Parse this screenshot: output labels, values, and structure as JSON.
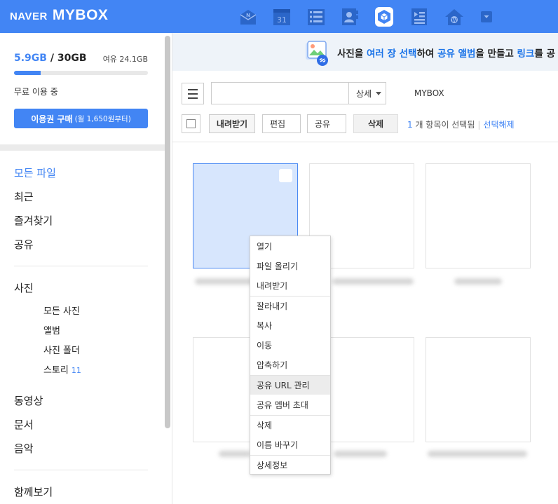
{
  "header": {
    "logo_naver": "NAVER",
    "logo_mybox": "MYBOX",
    "accent_color": "#4285f4",
    "apps": [
      "mail-icon",
      "calendar-icon",
      "list-icon",
      "contacts-icon",
      "mybox-icon",
      "memo-icon",
      "house-icon",
      "more-icon"
    ],
    "calendar_day": "31",
    "mail_letter": "N",
    "house_letter": "W"
  },
  "sidebar": {
    "storage_used": "5.9GB",
    "storage_sep": "/",
    "storage_total": "30GB",
    "storage_free": "여유 24.1GB",
    "storage_used_fraction": 0.197,
    "plan_text": "무료 이용 중",
    "buy_label": "이용권 구매",
    "buy_sub": "(월 1,650원부터)",
    "nav": {
      "all_files": "모든 파일",
      "recent": "최근",
      "favorites": "즐겨찾기",
      "shared": "공유",
      "photos": "사진",
      "videos": "동영상",
      "documents": "문서",
      "music": "음악",
      "together": "함께보기"
    },
    "photo_sub": {
      "all_photos": "모든 사진",
      "albums": "앨범",
      "photo_folders": "사진 폴더",
      "stories": "스토리",
      "stories_count": "11"
    }
  },
  "banner": {
    "p1": "사진을 ",
    "h1": "여러 장 선택",
    "p2": "하여 ",
    "h2": "공유 앨범",
    "p3": "을 만들고 ",
    "h3": "링크",
    "p4": "를 공"
  },
  "toolbar": {
    "search_value": "",
    "search_placeholder": "",
    "search_option": "상세",
    "path": "MYBOX",
    "download": "내려받기",
    "edit": "편집",
    "share": "공유",
    "delete": "삭제",
    "selected_count": "1",
    "selected_text": " 개 항목이 선택됨",
    "separator": "|",
    "deselect": "선택해제"
  },
  "context_menu": {
    "items": [
      "열기",
      "파일 올리기",
      "내려받기",
      "잘라내기",
      "복사",
      "이동",
      "압축하기",
      "공유 URL 관리",
      "공유 멤버 초대",
      "삭제",
      "이름 바꾸기",
      "상세정보"
    ],
    "hovered": "공유 URL 관리"
  }
}
